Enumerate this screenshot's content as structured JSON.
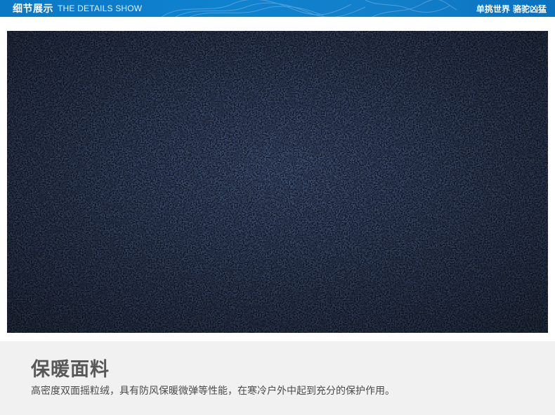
{
  "banner": {
    "title_cn": "细节展示",
    "title_en": "THE DETAILS SHOW",
    "slogan": "单挑世界 骆驼凶猛"
  },
  "fabric": {
    "base_color": "#0d1428",
    "highlight_color": "#1f3158"
  },
  "info": {
    "title": "保暖面料",
    "description": "高密度双面摇粒绒，具有防风保暖微弹等性能，在寒冷户外中起到充分的保护作用。"
  },
  "colors": {
    "banner_blue": "#0f82cf",
    "panel_gray": "#f1f1f1",
    "title_gray": "#585858",
    "text_gray": "#4a4a4a"
  }
}
